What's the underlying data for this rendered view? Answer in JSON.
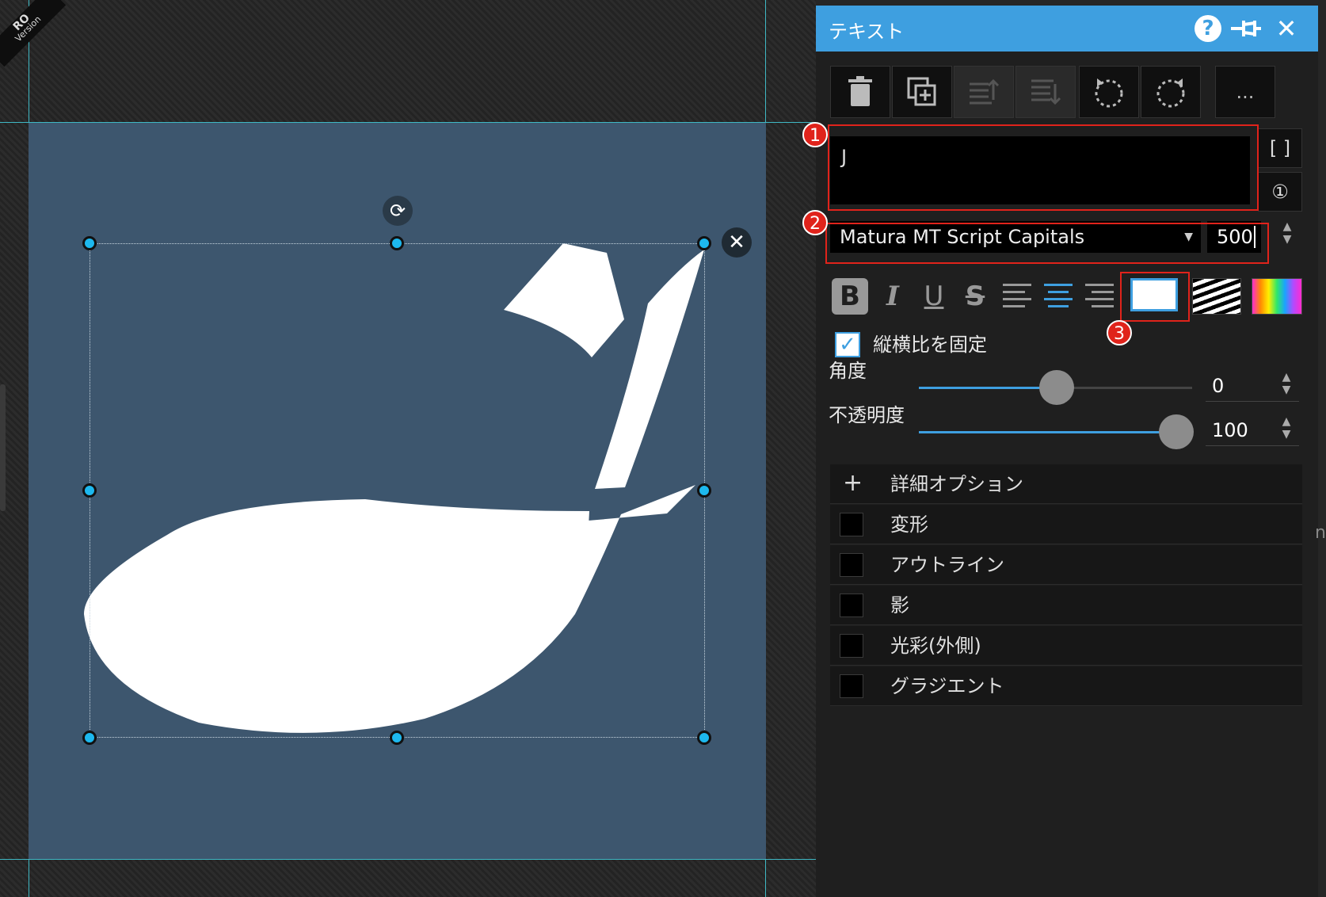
{
  "ribbon": {
    "line1": "RO",
    "line2": "Version"
  },
  "canvas": {
    "text": "J",
    "bg_color": "#3d566e",
    "text_color": "#ffffff",
    "guide_color": "#3fb8c4"
  },
  "panel": {
    "title": "テキスト",
    "header_color": "#3e9fe0",
    "toolbar": {
      "more_label": "..."
    },
    "text_value": "J",
    "bracket_label": "[ ]",
    "info_label": "①",
    "font_family": "Matura MT Script Capitals",
    "font_size": "500",
    "format": {
      "bold": "B",
      "italic": "I",
      "underline": "U",
      "strike": "S"
    },
    "aspect_label": "縦横比を固定",
    "aspect_checked": true,
    "angle": {
      "label": "角度",
      "value": "0"
    },
    "opacity": {
      "label": "不透明度",
      "value": "100"
    },
    "options": {
      "advanced": "詳細オプション",
      "transform": "変形",
      "outline": "アウトライン",
      "shadow": "影",
      "glow": "光彩(外側)",
      "gradient": "グラジエント"
    }
  },
  "annotations": {
    "one": "1",
    "two": "2",
    "three": "3",
    "color": "#e0231b"
  },
  "edge_glyph": "n"
}
